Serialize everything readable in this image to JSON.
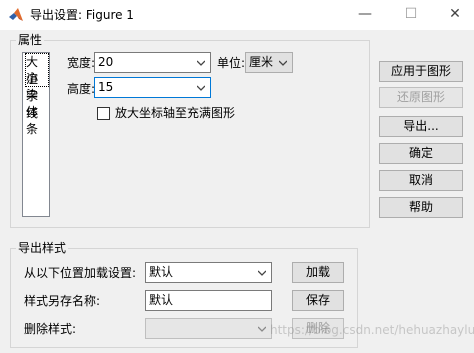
{
  "window": {
    "title": "导出设置: Figure 1",
    "controls": {
      "minimize": "—",
      "maximize": "☐",
      "close": "✕"
    }
  },
  "properties_group": {
    "title": "属性",
    "list_items": [
      "大小",
      "渲染",
      "字体",
      "线条"
    ],
    "selected_item": "大小",
    "width_label": "宽度:",
    "width_value": "20",
    "height_label": "高度:",
    "height_value": "15",
    "units_label": "单位:",
    "units_value": "厘米",
    "expand_checkbox_label": "放大坐标轴至充满图形",
    "expand_checked": false
  },
  "side_buttons": {
    "apply": "应用于图形",
    "restore": "还原图形",
    "export": "导出...",
    "ok": "确定",
    "cancel": "取消",
    "help": "帮助"
  },
  "style_group": {
    "title": "导出样式",
    "load_label": "从以下位置加载设置:",
    "load_value": "默认",
    "load_button": "加载",
    "save_label": "样式另存名称:",
    "save_value": "默认",
    "save_button": "保存",
    "delete_label": "删除样式:",
    "delete_value": "",
    "delete_button": "删除"
  },
  "watermark": "https://blog.csdn.net/hehuazhaylua",
  "colors": {
    "focus_border": "#0078d7",
    "matlab_orange": "#e06a2c",
    "matlab_blue": "#2f5fa8"
  }
}
